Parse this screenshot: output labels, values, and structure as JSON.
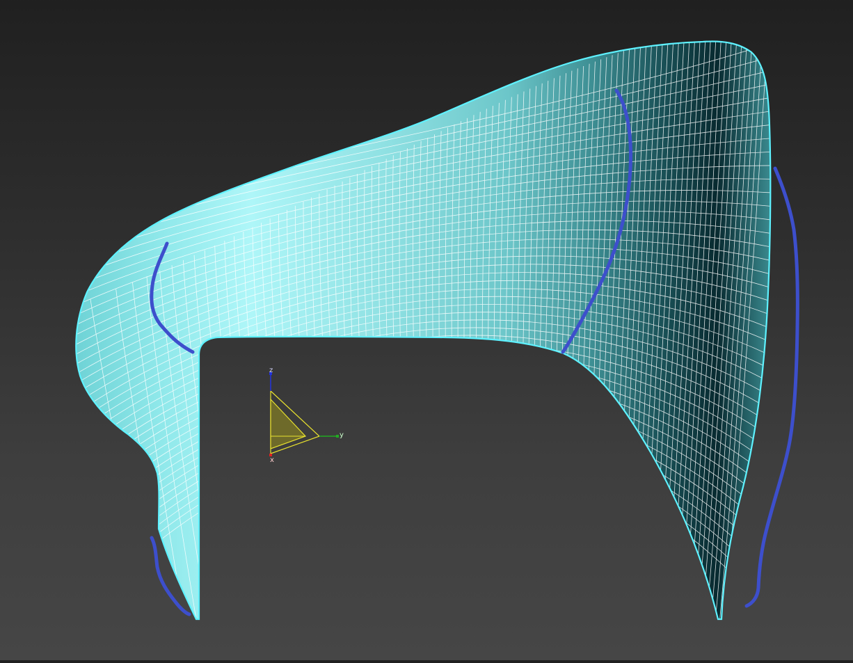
{
  "viewport": {
    "gizmo": {
      "axis_z": "z",
      "axis_y": "y",
      "axis_x": "x"
    }
  },
  "colors": {
    "background_top": "#202020",
    "background_bottom": "#464646",
    "surface_light": "#aef6f8",
    "surface_dark": "#082a30",
    "surface_edge": "#5ef2ff",
    "wire": "#ffffff",
    "annotation_stroke": "#3d4fcc",
    "gizmo_yellow": "#e8e12e",
    "gizmo_fill": "#6e6a2a",
    "axis_z_color": "#2233dd",
    "axis_y_color": "#22aa22",
    "axis_x_color": "#dd2222"
  }
}
